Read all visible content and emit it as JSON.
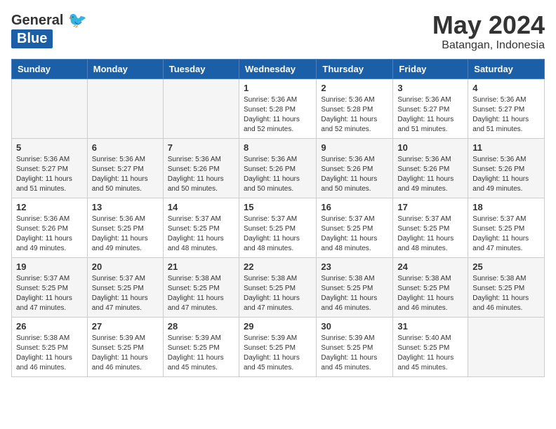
{
  "logo": {
    "general": "General",
    "blue": "Blue"
  },
  "title": "May 2024",
  "subtitle": "Batangan, Indonesia",
  "days_header": [
    "Sunday",
    "Monday",
    "Tuesday",
    "Wednesday",
    "Thursday",
    "Friday",
    "Saturday"
  ],
  "weeks": [
    [
      {
        "num": "",
        "info": ""
      },
      {
        "num": "",
        "info": ""
      },
      {
        "num": "",
        "info": ""
      },
      {
        "num": "1",
        "info": "Sunrise: 5:36 AM\nSunset: 5:28 PM\nDaylight: 11 hours\nand 52 minutes."
      },
      {
        "num": "2",
        "info": "Sunrise: 5:36 AM\nSunset: 5:28 PM\nDaylight: 11 hours\nand 52 minutes."
      },
      {
        "num": "3",
        "info": "Sunrise: 5:36 AM\nSunset: 5:27 PM\nDaylight: 11 hours\nand 51 minutes."
      },
      {
        "num": "4",
        "info": "Sunrise: 5:36 AM\nSunset: 5:27 PM\nDaylight: 11 hours\nand 51 minutes."
      }
    ],
    [
      {
        "num": "5",
        "info": "Sunrise: 5:36 AM\nSunset: 5:27 PM\nDaylight: 11 hours\nand 51 minutes."
      },
      {
        "num": "6",
        "info": "Sunrise: 5:36 AM\nSunset: 5:27 PM\nDaylight: 11 hours\nand 50 minutes."
      },
      {
        "num": "7",
        "info": "Sunrise: 5:36 AM\nSunset: 5:26 PM\nDaylight: 11 hours\nand 50 minutes."
      },
      {
        "num": "8",
        "info": "Sunrise: 5:36 AM\nSunset: 5:26 PM\nDaylight: 11 hours\nand 50 minutes."
      },
      {
        "num": "9",
        "info": "Sunrise: 5:36 AM\nSunset: 5:26 PM\nDaylight: 11 hours\nand 50 minutes."
      },
      {
        "num": "10",
        "info": "Sunrise: 5:36 AM\nSunset: 5:26 PM\nDaylight: 11 hours\nand 49 minutes."
      },
      {
        "num": "11",
        "info": "Sunrise: 5:36 AM\nSunset: 5:26 PM\nDaylight: 11 hours\nand 49 minutes."
      }
    ],
    [
      {
        "num": "12",
        "info": "Sunrise: 5:36 AM\nSunset: 5:26 PM\nDaylight: 11 hours\nand 49 minutes."
      },
      {
        "num": "13",
        "info": "Sunrise: 5:36 AM\nSunset: 5:25 PM\nDaylight: 11 hours\nand 49 minutes."
      },
      {
        "num": "14",
        "info": "Sunrise: 5:37 AM\nSunset: 5:25 PM\nDaylight: 11 hours\nand 48 minutes."
      },
      {
        "num": "15",
        "info": "Sunrise: 5:37 AM\nSunset: 5:25 PM\nDaylight: 11 hours\nand 48 minutes."
      },
      {
        "num": "16",
        "info": "Sunrise: 5:37 AM\nSunset: 5:25 PM\nDaylight: 11 hours\nand 48 minutes."
      },
      {
        "num": "17",
        "info": "Sunrise: 5:37 AM\nSunset: 5:25 PM\nDaylight: 11 hours\nand 48 minutes."
      },
      {
        "num": "18",
        "info": "Sunrise: 5:37 AM\nSunset: 5:25 PM\nDaylight: 11 hours\nand 47 minutes."
      }
    ],
    [
      {
        "num": "19",
        "info": "Sunrise: 5:37 AM\nSunset: 5:25 PM\nDaylight: 11 hours\nand 47 minutes."
      },
      {
        "num": "20",
        "info": "Sunrise: 5:37 AM\nSunset: 5:25 PM\nDaylight: 11 hours\nand 47 minutes."
      },
      {
        "num": "21",
        "info": "Sunrise: 5:38 AM\nSunset: 5:25 PM\nDaylight: 11 hours\nand 47 minutes."
      },
      {
        "num": "22",
        "info": "Sunrise: 5:38 AM\nSunset: 5:25 PM\nDaylight: 11 hours\nand 47 minutes."
      },
      {
        "num": "23",
        "info": "Sunrise: 5:38 AM\nSunset: 5:25 PM\nDaylight: 11 hours\nand 46 minutes."
      },
      {
        "num": "24",
        "info": "Sunrise: 5:38 AM\nSunset: 5:25 PM\nDaylight: 11 hours\nand 46 minutes."
      },
      {
        "num": "25",
        "info": "Sunrise: 5:38 AM\nSunset: 5:25 PM\nDaylight: 11 hours\nand 46 minutes."
      }
    ],
    [
      {
        "num": "26",
        "info": "Sunrise: 5:38 AM\nSunset: 5:25 PM\nDaylight: 11 hours\nand 46 minutes."
      },
      {
        "num": "27",
        "info": "Sunrise: 5:39 AM\nSunset: 5:25 PM\nDaylight: 11 hours\nand 46 minutes."
      },
      {
        "num": "28",
        "info": "Sunrise: 5:39 AM\nSunset: 5:25 PM\nDaylight: 11 hours\nand 45 minutes."
      },
      {
        "num": "29",
        "info": "Sunrise: 5:39 AM\nSunset: 5:25 PM\nDaylight: 11 hours\nand 45 minutes."
      },
      {
        "num": "30",
        "info": "Sunrise: 5:39 AM\nSunset: 5:25 PM\nDaylight: 11 hours\nand 45 minutes."
      },
      {
        "num": "31",
        "info": "Sunrise: 5:40 AM\nSunset: 5:25 PM\nDaylight: 11 hours\nand 45 minutes."
      },
      {
        "num": "",
        "info": ""
      }
    ]
  ]
}
